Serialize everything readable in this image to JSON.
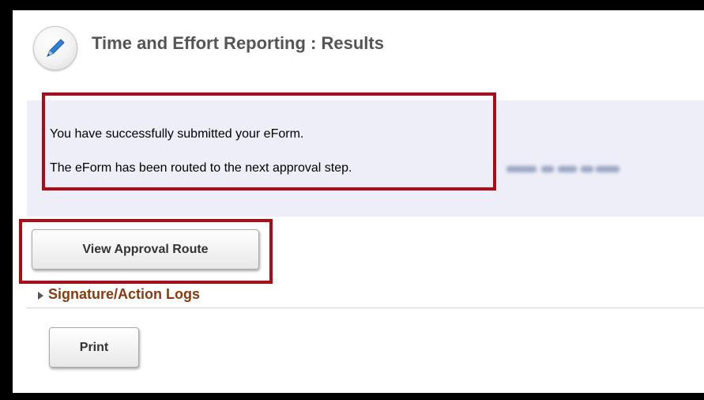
{
  "header": {
    "title": "Time and Effort Reporting : Results",
    "icon": "pencil-icon"
  },
  "message": {
    "line1": "You have successfully submitted your eForm.",
    "line2": "The eForm has been routed to the next approval step."
  },
  "buttons": {
    "view_approval_route": "View Approval Route",
    "print": "Print"
  },
  "sections": {
    "signature_logs": "Signature/Action Logs"
  },
  "colors": {
    "highlight": "#b00a17",
    "message_background": "#eeeef8",
    "section_link": "#8b3a0f",
    "title_text": "#555555"
  }
}
